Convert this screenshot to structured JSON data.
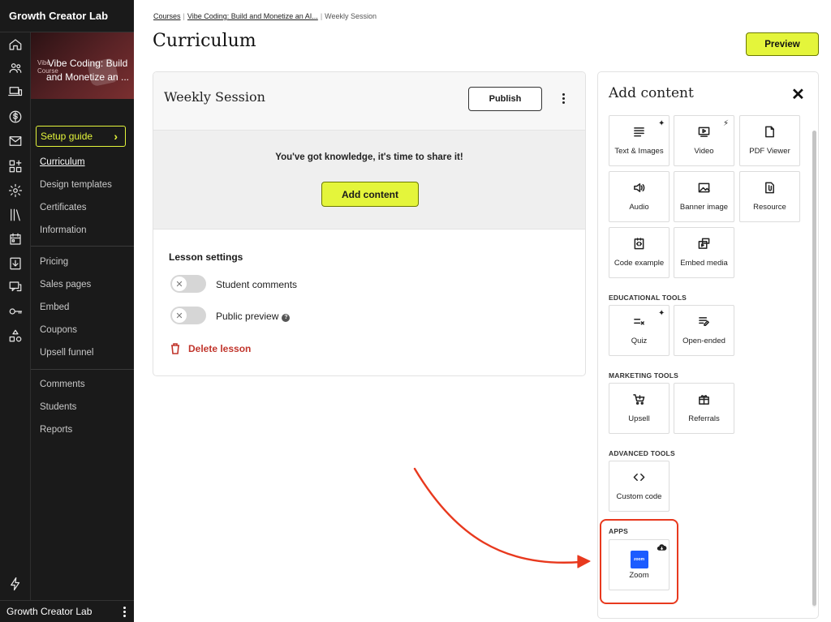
{
  "app": {
    "name": "Growth Creator Lab",
    "footer_name": "Growth Creator Lab"
  },
  "course": {
    "ghost_label": "Vibe\nCourse",
    "thumb_title": "Vibe Coding: Build and Monetize an ..."
  },
  "nav": {
    "setup_guide": "Setup guide",
    "items": [
      "Curriculum",
      "Design templates",
      "Certificates",
      "Information",
      "Pricing",
      "Sales pages",
      "Embed",
      "Coupons",
      "Upsell funnel",
      "Comments",
      "Students",
      "Reports"
    ],
    "active": "Curriculum"
  },
  "rail_icons": [
    "home-icon",
    "users-icon",
    "devices-icon",
    "dollar-icon",
    "mail-icon",
    "apps-icon",
    "gear-icon",
    "library-icon",
    "calendar-icon",
    "download-icon",
    "chat-icon",
    "key-icon",
    "shapes-icon",
    "bolt-icon"
  ],
  "breadcrumb": {
    "courses": "Courses",
    "course": "Vibe Coding: Build and Monetize an AI...",
    "current": "Weekly Session"
  },
  "page_title": "Curriculum",
  "preview_label": "Preview",
  "lesson": {
    "title": "Weekly Session",
    "publish_label": "Publish",
    "empty_message": "You've got knowledge, it's time to share it!",
    "add_content_label": "Add content",
    "settings_title": "Lesson settings",
    "student_comments": "Student comments",
    "public_preview": "Public preview",
    "help_glyph": "?",
    "delete_label": "Delete lesson"
  },
  "panel": {
    "title": "Add content",
    "close": "✕",
    "content_tiles": [
      "Text & Images",
      "Video",
      "PDF Viewer",
      "Audio",
      "Banner image",
      "Resource",
      "Code example",
      "Embed media"
    ],
    "educational_title": "EDUCATIONAL TOOLS",
    "educational_tiles": [
      "Quiz",
      "Open-ended"
    ],
    "marketing_title": "MARKETING TOOLS",
    "marketing_tiles": [
      "Upsell",
      "Referrals"
    ],
    "advanced_title": "ADVANCED TOOLS",
    "advanced_tiles": [
      "Custom code"
    ],
    "apps_title": "APPS",
    "apps_tiles": [
      "Zoom"
    ],
    "zoom_logo_text": "zoom"
  },
  "colors": {
    "accent": "#e4f53b",
    "danger": "#c1352c",
    "annotation": "#e8391e",
    "sidebar_bg": "#1a1a1a",
    "zoom_blue": "#1c5cff"
  }
}
